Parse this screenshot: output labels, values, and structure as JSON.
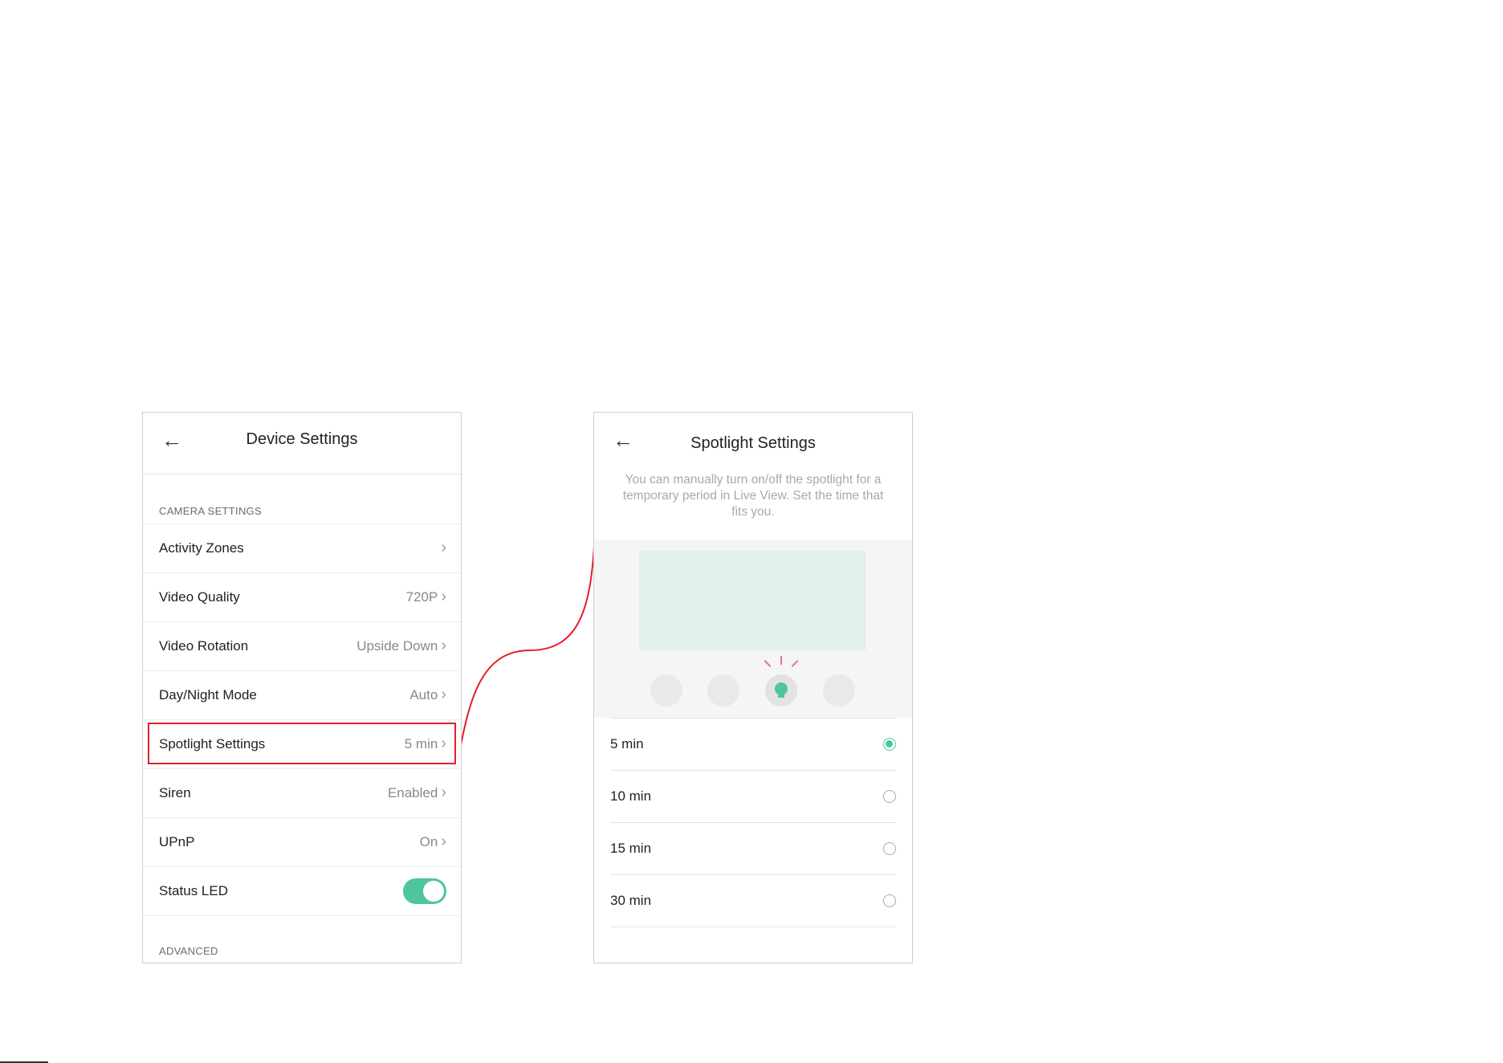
{
  "left_screen": {
    "title": "Device Settings",
    "back_icon": "arrow-left-icon",
    "section_camera": "CAMERA SETTINGS",
    "section_advanced": "ADVANCED",
    "rows": [
      {
        "label": "Activity Zones",
        "value": ""
      },
      {
        "label": "Video Quality",
        "value": "720P"
      },
      {
        "label": "Video Rotation",
        "value": "Upside Down"
      },
      {
        "label": "Day/Night Mode",
        "value": "Auto"
      },
      {
        "label": "Spotlight Settings",
        "value": "5 min"
      },
      {
        "label": "Siren",
        "value": "Enabled"
      },
      {
        "label": "UPnP",
        "value": "On"
      }
    ],
    "status_led": {
      "label": "Status LED",
      "enabled": true
    },
    "highlight_color": "#e0202a"
  },
  "right_screen": {
    "title": "Spotlight Settings",
    "back_icon": "arrow-left-icon",
    "description": "You can manually turn on/off the spotlight for a temporary period in Live View. Set the time that fits you.",
    "illustration_icon": "lightbulb-icon",
    "options": [
      {
        "label": "5 min",
        "selected": true
      },
      {
        "label": "10 min",
        "selected": false
      },
      {
        "label": "15 min",
        "selected": false
      },
      {
        "label": "30 min",
        "selected": false
      }
    ],
    "accent_color": "#4dc59e"
  }
}
